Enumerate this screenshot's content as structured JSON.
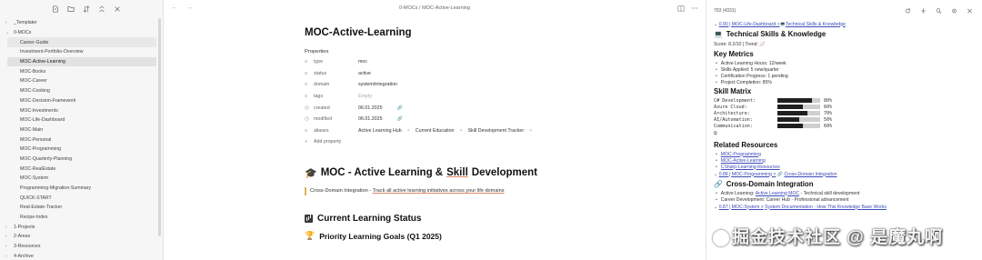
{
  "sidebar": {
    "toolbar_icons": [
      "new-note-icon",
      "new-folder-icon",
      "sort-icon",
      "collapse-icon",
      "close-icon"
    ],
    "tree": [
      {
        "type": "folder",
        "label": "_Templater",
        "caret": "›",
        "state": "normal"
      },
      {
        "type": "folder",
        "label": "0-MOCs",
        "caret": "⌄",
        "state": "normal"
      },
      {
        "type": "file",
        "label": "Career-Guide",
        "state": "highlight"
      },
      {
        "type": "file",
        "label": "Investment-Portfolio-Overview",
        "state": "normal"
      },
      {
        "type": "file",
        "label": "MOC-Active-Learning",
        "state": "active"
      },
      {
        "type": "file",
        "label": "MOC-Books",
        "state": "normal"
      },
      {
        "type": "file",
        "label": "MOC-Career",
        "state": "normal"
      },
      {
        "type": "file",
        "label": "MOC-Cooking",
        "state": "normal"
      },
      {
        "type": "file",
        "label": "MOC-Decision-Framework",
        "state": "normal"
      },
      {
        "type": "file",
        "label": "MOC-Investments",
        "state": "normal"
      },
      {
        "type": "file",
        "label": "MOC-Life-Dashboard",
        "state": "normal"
      },
      {
        "type": "file",
        "label": "MOC-Main",
        "state": "normal"
      },
      {
        "type": "file",
        "label": "MOC-Personal",
        "state": "normal"
      },
      {
        "type": "file",
        "label": "MOC-Programming",
        "state": "normal"
      },
      {
        "type": "file",
        "label": "MOC-Quarterly-Planning",
        "state": "normal"
      },
      {
        "type": "file",
        "label": "MOC-RealEstate",
        "state": "normal"
      },
      {
        "type": "file",
        "label": "MOC-System",
        "state": "normal"
      },
      {
        "type": "file",
        "label": "Programming-Migration-Summary",
        "state": "normal"
      },
      {
        "type": "file",
        "label": "QUICK-START",
        "state": "normal"
      },
      {
        "type": "file",
        "label": "Real-Estate-Tracker",
        "state": "normal"
      },
      {
        "type": "file",
        "label": "Recipe-Index",
        "state": "normal"
      },
      {
        "type": "folder",
        "label": "1-Projects",
        "caret": "›",
        "state": "normal"
      },
      {
        "type": "folder",
        "label": "2-Areas",
        "caret": "›",
        "state": "normal"
      },
      {
        "type": "folder",
        "label": "3-Resources",
        "caret": "›",
        "state": "normal"
      },
      {
        "type": "folder",
        "label": "4-Archive",
        "caret": "›",
        "state": "normal"
      }
    ]
  },
  "main": {
    "breadcrumb": "0-MOCs / MOC-Active-Learning",
    "nav_back": "←",
    "nav_forward": "→",
    "title": "MOC-Active-Learning",
    "properties_label": "Properties",
    "properties": [
      {
        "icon": "≡",
        "key": "type",
        "value": "moc"
      },
      {
        "icon": "≡",
        "key": "status",
        "value": "active"
      },
      {
        "icon": "≡",
        "key": "domain",
        "value": "system/integration"
      },
      {
        "icon": "≡",
        "key": "tags",
        "value": "Empty",
        "empty": true
      },
      {
        "icon": "◷",
        "key": "created",
        "value": "06.01.2025"
      },
      {
        "icon": "◷",
        "key": "modified",
        "value": "06.01.2025"
      },
      {
        "icon": "≡",
        "key": "aliases",
        "chips": [
          "Active Learning Hub",
          "Current Education",
          "Skill Development Tracker"
        ]
      }
    ],
    "add_property": "Add property",
    "heading1_prefix": "MOC - Active Learning &",
    "heading1_underlined": "Skill",
    "heading1_suffix": "Development",
    "quote_text": "Cross-Domain Integration -",
    "quote_underlined": "Track all active learning initiatives across your life domains",
    "heading2": "Current Learning Status",
    "heading3": "Priority Learning Goals (Q1 2025)"
  },
  "right": {
    "count": "703 (4331)",
    "icons": [
      "refresh-icon",
      "pin-icon",
      "search-icon",
      "settings-icon",
      "close-icon"
    ],
    "link1_prefix": "0.90 | MOC-Life-Dashboard >",
    "link1_emoji": "💻",
    "link1_target": "Technical Skills & Knowledge",
    "section1_title": "Technical Skills & Knowledge",
    "score_line": "Score: 8.2/10 | Trend:",
    "key_metrics_title": "Key Metrics",
    "metrics": [
      "Active Learning Hours: 12/week",
      "Skills Applied: 5 new/quarter",
      "Certification Progress: 1 pending",
      "Project Completion: 85%"
    ],
    "skill_matrix_title": "Skill Matrix",
    "skills": [
      {
        "label": "C# Development:",
        "value": 80,
        "text": "80%"
      },
      {
        "label": "Azure Cloud:",
        "value": 60,
        "text": "60%"
      },
      {
        "label": "Architecture:",
        "value": 70,
        "text": "70%"
      },
      {
        "label": "AI/Automation:",
        "value": 50,
        "text": "50%"
      },
      {
        "label": "Communication:",
        "value": 60,
        "text": "60%"
      }
    ],
    "related_title": "Related Resources",
    "related": [
      "MOC-Programming",
      "MOC-Active-Learning",
      "CSharp-Learning-Resources"
    ],
    "link2_prefix": "0.88 | MOC-Programming >",
    "link2_target": "Cross-Domain Integration",
    "section2_title": "Cross-Domain Integration",
    "integration_label": "Active Learning:",
    "integration_link": "Active Learning MOC",
    "integration_rest": "- Technical skill development",
    "integration_line2": "Career Development: Career Hub - Professional advancement",
    "link3_prefix": "0.87 | MOC-System >",
    "link3_target": "System Documentation - How This Knowledge Base Works"
  },
  "watermark": "掘金技术社区 @ 是魔丸啊"
}
